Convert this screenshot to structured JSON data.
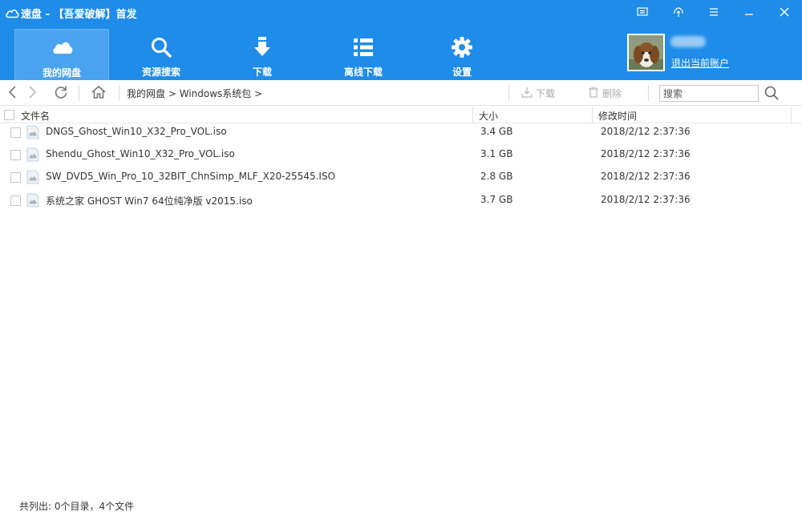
{
  "window": {
    "title": "速盘 - 【吾爱破解】首发",
    "buttons": [
      "feedback-icon",
      "skin-icon",
      "menu-icon",
      "minimize-icon",
      "close-icon"
    ]
  },
  "nav": {
    "tabs": [
      {
        "label": "我的网盘",
        "icon": "cloud-icon",
        "active": true
      },
      {
        "label": "资源搜索",
        "icon": "search-icon",
        "active": false
      },
      {
        "label": "下载",
        "icon": "download-icon",
        "active": false
      },
      {
        "label": "离线下载",
        "icon": "list-icon",
        "active": false
      },
      {
        "label": "设置",
        "icon": "gear-icon",
        "active": false
      }
    ],
    "logout_label": "退出当前账户"
  },
  "addressbar": {
    "breadcrumb": [
      "我的网盘",
      "Windows系统包"
    ],
    "separator": ">",
    "download_label": "下载",
    "delete_label": "删除",
    "search_placeholder": "搜索"
  },
  "list": {
    "columns": {
      "name": "文件名",
      "size": "大小",
      "modified": "修改时间"
    },
    "files": [
      {
        "name": "DNGS_Ghost_Win10_X32_Pro_VOL.iso",
        "size": "3.4 GB",
        "modified": "2018/2/12 2:37:36"
      },
      {
        "name": "Shendu_Ghost_Win10_X32_Pro_VOL.iso",
        "size": "3.1 GB",
        "modified": "2018/2/12 2:37:36"
      },
      {
        "name": "SW_DVD5_Win_Pro_10_32BIT_ChnSimp_MLF_X20-25545.ISO",
        "size": "2.8 GB",
        "modified": "2018/2/12 2:37:36"
      },
      {
        "name": "系统之家 GHOST Win7 64位纯净版 v2015.iso",
        "size": "3.7 GB",
        "modified": "2018/2/12 2:37:36"
      }
    ]
  },
  "status": {
    "text": "共列出: 0个目录，4个文件"
  },
  "colors": {
    "brand": "#1e8ce8",
    "active_tab": "#4aa3ef",
    "disabled_text": "#aaaaaa"
  }
}
